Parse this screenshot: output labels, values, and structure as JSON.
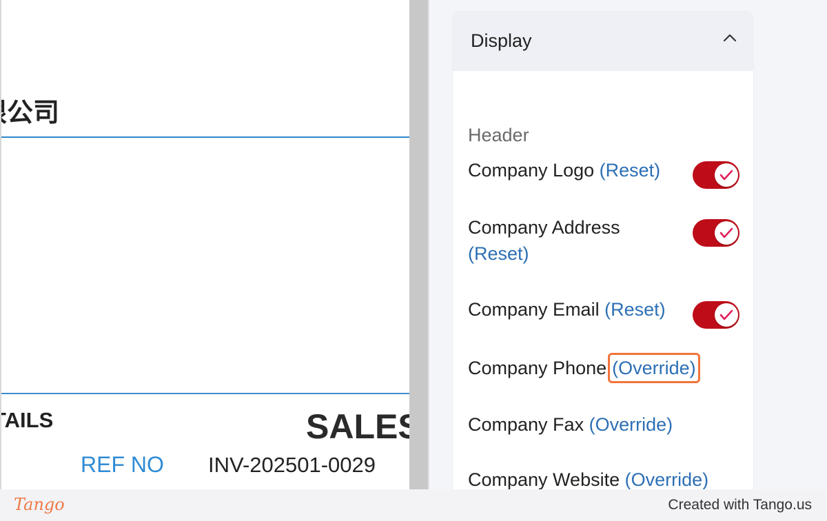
{
  "preview": {
    "company_name_partial": "限公司",
    "details_heading_partial": "TAILS",
    "document_type_partial": "SALES",
    "ref_label": "REF NO",
    "ref_value": "INV-202501-0029"
  },
  "settings": {
    "panel_title": "Display",
    "section": "Header",
    "rows": [
      {
        "label": "Company Logo",
        "link": "(Reset)",
        "toggle_on": true
      },
      {
        "label": "Company Address",
        "link": "(Reset)",
        "toggle_on": true
      },
      {
        "label": "Company Email",
        "link": "(Reset)",
        "toggle_on": true
      },
      {
        "label": "Company Phone",
        "link": "(Override)",
        "toggle_on": null,
        "highlighted": true
      },
      {
        "label": "Company Fax",
        "link": "(Override)",
        "toggle_on": null
      },
      {
        "label": "Company Website",
        "link": "(Override)",
        "toggle_on": null
      }
    ]
  },
  "colors": {
    "toggle_on": "#be0d19",
    "check": "#e0215a",
    "link": "#2c6fb4",
    "highlight": "#f2743a",
    "rule": "#2f86c9"
  },
  "footer": {
    "logo_text": "Tango",
    "credit": "Created with Tango.us"
  }
}
